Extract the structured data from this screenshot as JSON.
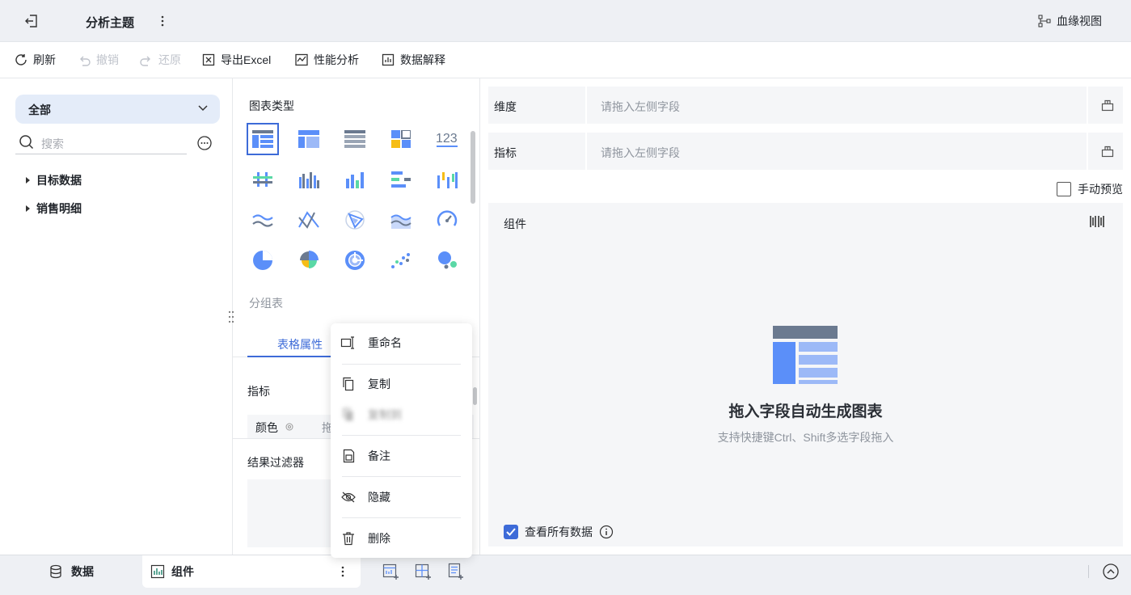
{
  "header": {
    "title": "分析主题",
    "lineage_label": "血缘视图"
  },
  "toolbar": {
    "refresh": "刷新",
    "undo": "撤销",
    "redo": "还原",
    "export": "导出Excel",
    "perf": "性能分析",
    "explain": "数据解释"
  },
  "left_panel": {
    "filter_value": "全部",
    "search_placeholder": "搜索",
    "tree": [
      "目标数据",
      "销售明细"
    ]
  },
  "middle_panel": {
    "chart_type_label": "图表类型",
    "group_label": "分组表",
    "tab_label": "表格属性",
    "metric_label": "指标",
    "color_label": "颜色",
    "color_hint": "拖",
    "result_filter_label": "结果过滤器"
  },
  "context_menu": {
    "items": [
      "重命名",
      "复制",
      "复制到",
      "备注",
      "隐藏",
      "删除"
    ]
  },
  "right_panel": {
    "dimension_label": "维度",
    "metric_label": "指标",
    "drop_placeholder": "请拖入左侧字段",
    "manual_preview": "手动预览",
    "component_label": "组件",
    "empty_title": "拖入字段自动生成图表",
    "empty_subtitle": "支持快捷键Ctrl、Shift多选字段拖入",
    "view_all_label": "查看所有数据"
  },
  "bottom_bar": {
    "data_tab": "数据",
    "component_tab": "组件"
  },
  "colors": {
    "accent": "#3d6bd8",
    "chart_blue": "#5b8ff9",
    "chart_teal": "#5ad8a6",
    "chart_orange": "#f6bd16"
  }
}
